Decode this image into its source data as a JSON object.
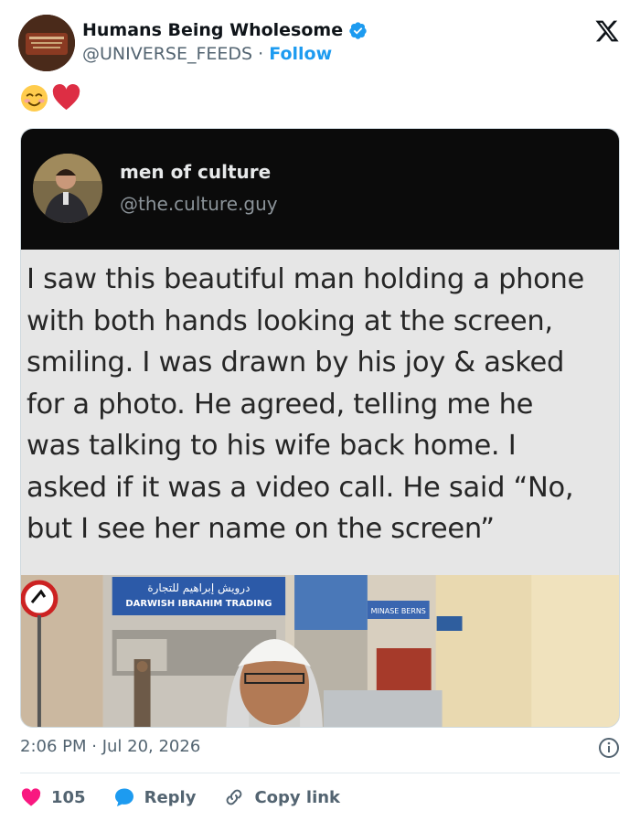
{
  "author": {
    "display_name": "Humans Being Wholesome",
    "handle": "@UNIVERSE_FEEDS",
    "separator": "·",
    "follow_label": "Follow"
  },
  "post": {
    "emoji": "☺️❤️"
  },
  "quoted": {
    "name": "men of culture",
    "handle": "@the.culture.guy",
    "text_lines": [
      "I saw this beautiful man holding a phone",
      "with both hands looking at the screen,",
      "smiling. I was drawn by his joy & asked",
      "for a photo. He agreed, telling me he",
      "was talking to his wife back home. I",
      "asked if it was a video call. He said “No,",
      "but I see her name on the screen”"
    ],
    "photo_signs": {
      "arabic": "درويش إبراهيم للتجارة",
      "english": "DARWISH IBRAHIM TRADING",
      "shop": "MINASE BERNS"
    }
  },
  "meta": {
    "timestamp": "2:06 PM · Jul 20, 2026"
  },
  "actions": {
    "likes": "105",
    "reply_label": "Reply",
    "copy_label": "Copy link"
  },
  "colors": {
    "accent": "#1d9bf0",
    "like": "#f91880",
    "muted": "#536471"
  }
}
